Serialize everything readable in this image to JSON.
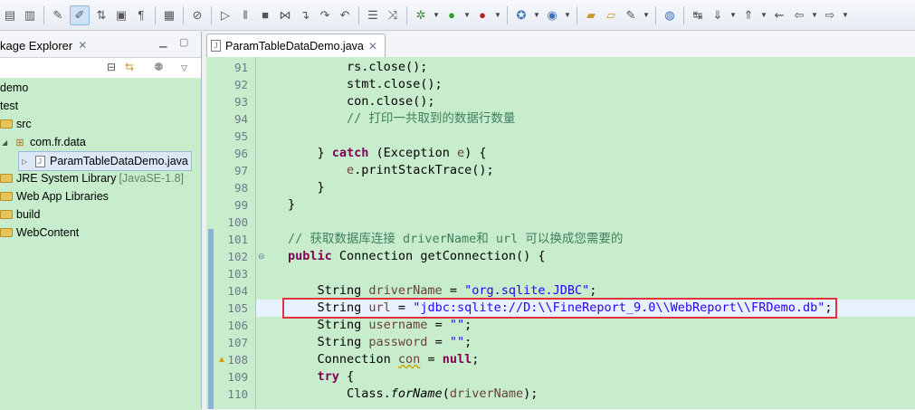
{
  "left_panel": {
    "tab_title": "kage Explorer",
    "tree": [
      {
        "indent": 0,
        "icon": "none",
        "label": "demo",
        "deco": ""
      },
      {
        "indent": 0,
        "icon": "none",
        "label": "test",
        "deco": ""
      },
      {
        "indent": 0,
        "icon": "folder",
        "label": "src",
        "deco": ""
      },
      {
        "indent": 1,
        "icon": "package",
        "label": "com.fr.data",
        "deco": ""
      },
      {
        "indent": 2,
        "icon": "java",
        "label": "ParamTableDataDemo.java",
        "deco": "",
        "selected": true
      },
      {
        "indent": 0,
        "icon": "folder",
        "label": "JRE System Library",
        "deco": "[JavaSE-1.8]"
      },
      {
        "indent": 0,
        "icon": "folder",
        "label": "Web App Libraries",
        "deco": ""
      },
      {
        "indent": 0,
        "icon": "folder",
        "label": "build",
        "deco": ""
      },
      {
        "indent": 0,
        "icon": "folder",
        "label": "WebContent",
        "deco": ""
      }
    ]
  },
  "editor": {
    "tab_title": "ParamTableDataDemo.java",
    "line_numbers": [
      "91",
      "92",
      "93",
      "94",
      "95",
      "96",
      "97",
      "98",
      "99",
      "100",
      "101",
      "102",
      "103",
      "104",
      "105",
      "106",
      "107",
      "108",
      "109",
      "110"
    ],
    "lines": [
      [
        {
          "t": "        rs.close();",
          "c": ""
        }
      ],
      [
        {
          "t": "        stmt.close();",
          "c": ""
        }
      ],
      [
        {
          "t": "        con.close();",
          "c": ""
        }
      ],
      [
        {
          "t": "        // 打印一共取到的数据行数量",
          "c": "cmt"
        }
      ],
      [
        {
          "t": "",
          "c": ""
        }
      ],
      [
        {
          "t": "    } ",
          "c": ""
        },
        {
          "t": "catch",
          "c": "kw"
        },
        {
          "t": " (Exception ",
          "c": ""
        },
        {
          "t": "e",
          "c": "var"
        },
        {
          "t": ") {",
          "c": ""
        }
      ],
      [
        {
          "t": "        ",
          "c": ""
        },
        {
          "t": "e",
          "c": "var"
        },
        {
          "t": ".printStackTrace();",
          "c": ""
        }
      ],
      [
        {
          "t": "    }",
          "c": ""
        }
      ],
      [
        {
          "t": "}",
          "c": ""
        }
      ],
      [
        {
          "t": "",
          "c": ""
        }
      ],
      [
        {
          "t": "// 获取数据库连接 driverName和 url 可以换成您需要的",
          "c": "cmt"
        }
      ],
      [
        {
          "t": "public",
          "c": "kw"
        },
        {
          "t": " Connection getConnection() {",
          "c": ""
        }
      ],
      [
        {
          "t": "",
          "c": ""
        }
      ],
      [
        {
          "t": "    String ",
          "c": ""
        },
        {
          "t": "driverName",
          "c": "var"
        },
        {
          "t": " = ",
          "c": ""
        },
        {
          "t": "\"org.sqlite.JDBC\"",
          "c": "str"
        },
        {
          "t": ";",
          "c": ""
        }
      ],
      [
        {
          "t": "    String ",
          "c": ""
        },
        {
          "t": "url",
          "c": "var"
        },
        {
          "t": " = ",
          "c": ""
        },
        {
          "t": "\"jdbc:sqlite://D:\\\\FineReport_9.0\\\\WebReport\\\\FRDemo.db\"",
          "c": "str"
        },
        {
          "t": ";",
          "c": ""
        }
      ],
      [
        {
          "t": "    String ",
          "c": ""
        },
        {
          "t": "username",
          "c": "var"
        },
        {
          "t": " = ",
          "c": ""
        },
        {
          "t": "\"\"",
          "c": "str"
        },
        {
          "t": ";",
          "c": ""
        }
      ],
      [
        {
          "t": "    String ",
          "c": ""
        },
        {
          "t": "password",
          "c": "var"
        },
        {
          "t": " = ",
          "c": ""
        },
        {
          "t": "\"\"",
          "c": "str"
        },
        {
          "t": ";",
          "c": ""
        }
      ],
      [
        {
          "t": "    Connection ",
          "c": ""
        },
        {
          "t": "con",
          "c": "var squig"
        },
        {
          "t": " = ",
          "c": ""
        },
        {
          "t": "null",
          "c": "kw"
        },
        {
          "t": ";",
          "c": ""
        }
      ],
      [
        {
          "t": "    ",
          "c": ""
        },
        {
          "t": "try",
          "c": "kw"
        },
        {
          "t": " {",
          "c": ""
        }
      ],
      [
        {
          "t": "        Class.",
          "c": ""
        },
        {
          "t": "forName",
          "c": "stat"
        },
        {
          "t": "(",
          "c": ""
        },
        {
          "t": "driverName",
          "c": "var"
        },
        {
          "t": ");",
          "c": ""
        }
      ]
    ],
    "current_line_index": 14,
    "highlight_line_index": 14,
    "fold_markers": [
      11
    ],
    "warning_markers": [
      17
    ]
  }
}
